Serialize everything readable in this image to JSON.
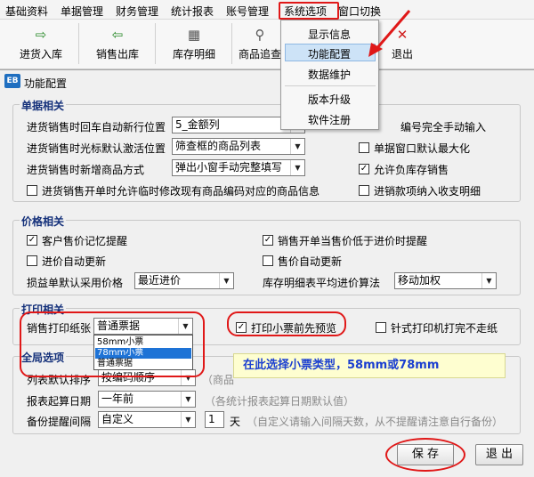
{
  "menubar": {
    "items": [
      "基础资料",
      "单据管理",
      "财务管理",
      "统计报表",
      "账号管理",
      "系统选项",
      "窗口切换"
    ]
  },
  "toolbar": {
    "buttons": [
      "进货入库",
      "销售出库",
      "库存明细",
      "商品追查",
      "退出"
    ]
  },
  "system_menu": {
    "items": [
      "显示信息",
      "功能配置",
      "数据维护",
      "版本升级",
      "软件注册"
    ],
    "highlighted": "功能配置"
  },
  "dialog": {
    "title": "功能配置",
    "icon_text": "EB",
    "group_document": {
      "title": "单据相关",
      "row1_label": "进货销售时回车自动新行位置",
      "row1_value": "5_金额列",
      "row1_right_label": "编号完全手动输入",
      "row2_label": "进货销售时光标默认激活位置",
      "row2_value": "筛查框的商品列表",
      "row2_right_label": "单据窗口默认最大化",
      "row3_label": "进货销售时新增商品方式",
      "row3_value": "弹出小窗手动完整填写",
      "row3_right_label": "允许负库存销售",
      "row4_label": "进货销售开单时允许临时修改现有商品编码对应的商品信息",
      "row4_right_label": "进销款项纳入收支明细"
    },
    "group_price": {
      "title": "价格相关",
      "check1": "客户售价记忆提醒",
      "check2": "销售开单当售价低于进价时提醒",
      "check3": "进价自动更新",
      "check4": "售价自动更新",
      "loss_label": "损益单默认采用价格",
      "loss_value": "最近进价",
      "avg_label": "库存明细表平均进价算法",
      "avg_value": "移动加权"
    },
    "group_print": {
      "title": "打印相关",
      "paper_label": "销售打印纸张",
      "paper_value": "普通票据",
      "paper_options": [
        "58mm小票",
        "78mm小票",
        "普通票据"
      ],
      "paper_selected": "78mm小票",
      "preview_label": "打印小票前先预览",
      "needle_label": "针式打印机打完不走纸"
    },
    "group_global": {
      "title": "全局选项",
      "sort_label": "列表默认排序",
      "sort_value": "按编码顺序",
      "sort_note": "（商品",
      "report_label": "报表起算日期",
      "report_value": "一年前",
      "report_note": "（各统计报表起算日期默认值）",
      "backup_label": "备份提醒间隔",
      "backup_value": "自定义",
      "backup_days": "1",
      "backup_unit": "天",
      "backup_note": "（自定义请输入间隔天数，从不提醒请注意自行备份）"
    },
    "callout_text": "在此选择小票类型，58mm或78mm",
    "save_label": "保 存",
    "exit_label": "退 出"
  }
}
